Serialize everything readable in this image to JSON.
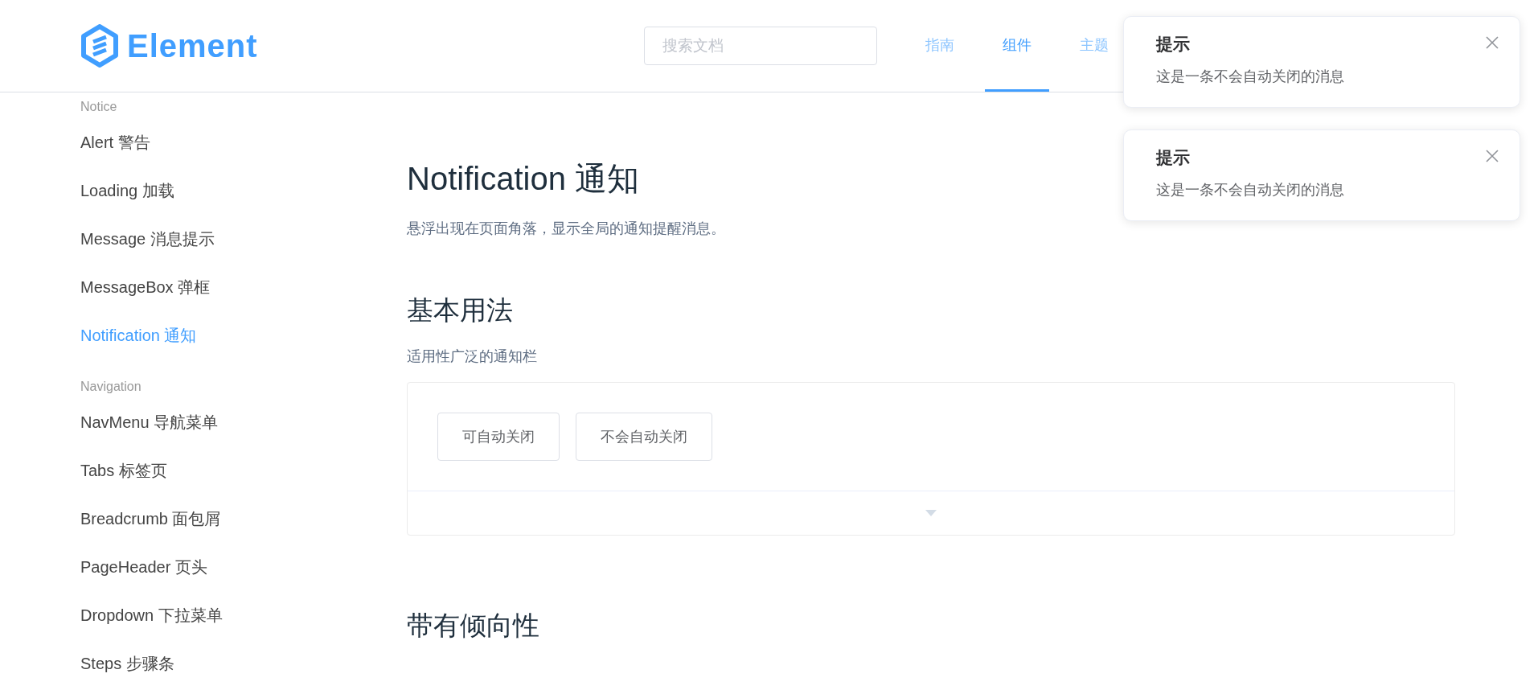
{
  "header": {
    "logo": "Element",
    "search": {
      "placeholder": "搜索文档"
    },
    "nav": [
      {
        "label": "指南",
        "selected": false
      },
      {
        "label": "组件",
        "selected": true
      },
      {
        "label": "主题",
        "selected": false
      }
    ]
  },
  "sidebar": {
    "groups": [
      {
        "title": "Notice",
        "items": [
          {
            "label": "Alert 警告",
            "selected": false
          },
          {
            "label": "Loading 加载",
            "selected": false
          },
          {
            "label": "Message 消息提示",
            "selected": false
          },
          {
            "label": "MessageBox 弹框",
            "selected": false
          },
          {
            "label": "Notification 通知",
            "selected": true
          }
        ]
      },
      {
        "title": "Navigation",
        "items": [
          {
            "label": "NavMenu 导航菜单",
            "selected": false
          },
          {
            "label": "Tabs 标签页",
            "selected": false
          },
          {
            "label": "Breadcrumb 面包屑",
            "selected": false
          },
          {
            "label": "PageHeader 页头",
            "selected": false
          },
          {
            "label": "Dropdown 下拉菜单",
            "selected": false
          },
          {
            "label": "Steps 步骤条",
            "selected": false
          }
        ]
      }
    ]
  },
  "content": {
    "title": "Notification 通知",
    "description": "悬浮出现在页面角落，显示全局的通知提醒消息。",
    "sections": [
      {
        "heading": "基本用法",
        "description": "适用性广泛的通知栏",
        "demo": {
          "buttons": [
            "可自动关闭",
            "不会自动关闭"
          ]
        }
      },
      {
        "heading": "带有倾向性"
      }
    ]
  },
  "notifications": [
    {
      "title": "提示",
      "message": "这是一条不会自动关闭的消息"
    },
    {
      "title": "提示",
      "message": "这是一条不会自动关闭的消息"
    }
  ]
}
